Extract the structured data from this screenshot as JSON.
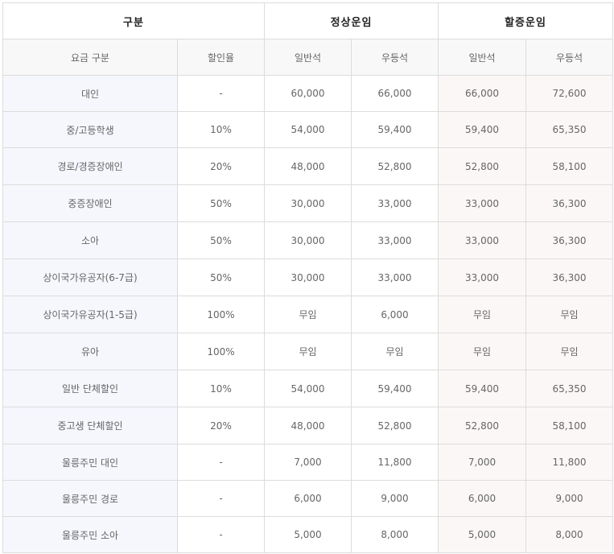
{
  "header": {
    "category": "구분",
    "normal_fare": "정상운임",
    "surcharge_fare": "할증운임"
  },
  "subheader": {
    "fare_type": "요금 구분",
    "discount_rate": "할인율",
    "normal_standard": "일반석",
    "normal_premium": "우등석",
    "surcharge_standard": "일반석",
    "surcharge_premium": "우등석"
  },
  "rows": [
    {
      "type": "대인",
      "discount": "-",
      "normal_standard": "60,000",
      "normal_premium": "66,000",
      "surcharge_standard": "66,000",
      "surcharge_premium": "72,600"
    },
    {
      "type": "중/고등학생",
      "discount": "10%",
      "normal_standard": "54,000",
      "normal_premium": "59,400",
      "surcharge_standard": "59,400",
      "surcharge_premium": "65,350"
    },
    {
      "type": "경로/경증장애인",
      "discount": "20%",
      "normal_standard": "48,000",
      "normal_premium": "52,800",
      "surcharge_standard": "52,800",
      "surcharge_premium": "58,100"
    },
    {
      "type": "중증장애인",
      "discount": "50%",
      "normal_standard": "30,000",
      "normal_premium": "33,000",
      "surcharge_standard": "33,000",
      "surcharge_premium": "36,300"
    },
    {
      "type": "소아",
      "discount": "50%",
      "normal_standard": "30,000",
      "normal_premium": "33,000",
      "surcharge_standard": "33,000",
      "surcharge_premium": "36,300"
    },
    {
      "type": "상이국가유공자(6-7급)",
      "discount": "50%",
      "normal_standard": "30,000",
      "normal_premium": "33,000",
      "surcharge_standard": "33,000",
      "surcharge_premium": "36,300"
    },
    {
      "type": "상이국가유공자(1-5급)",
      "discount": "100%",
      "normal_standard": "무임",
      "normal_premium": "6,000",
      "surcharge_standard": "무임",
      "surcharge_premium": "무임"
    },
    {
      "type": "유아",
      "discount": "100%",
      "normal_standard": "무임",
      "normal_premium": "무임",
      "surcharge_standard": "무임",
      "surcharge_premium": "무임"
    },
    {
      "type": "일반 단체할인",
      "discount": "10%",
      "normal_standard": "54,000",
      "normal_premium": "59,400",
      "surcharge_standard": "59,400",
      "surcharge_premium": "65,350"
    },
    {
      "type": "중고생 단체할인",
      "discount": "20%",
      "normal_standard": "48,000",
      "normal_premium": "52,800",
      "surcharge_standard": "52,800",
      "surcharge_premium": "58,100"
    },
    {
      "type": "울릉주민 대인",
      "discount": "-",
      "normal_standard": "7,000",
      "normal_premium": "11,800",
      "surcharge_standard": "7,000",
      "surcharge_premium": "11,800"
    },
    {
      "type": "울릉주민 경로",
      "discount": "-",
      "normal_standard": "6,000",
      "normal_premium": "9,000",
      "surcharge_standard": "6,000",
      "surcharge_premium": "9,000"
    },
    {
      "type": "울릉주민 소아",
      "discount": "-",
      "normal_standard": "5,000",
      "normal_premium": "8,000",
      "surcharge_standard": "5,000",
      "surcharge_premium": "8,000"
    }
  ]
}
